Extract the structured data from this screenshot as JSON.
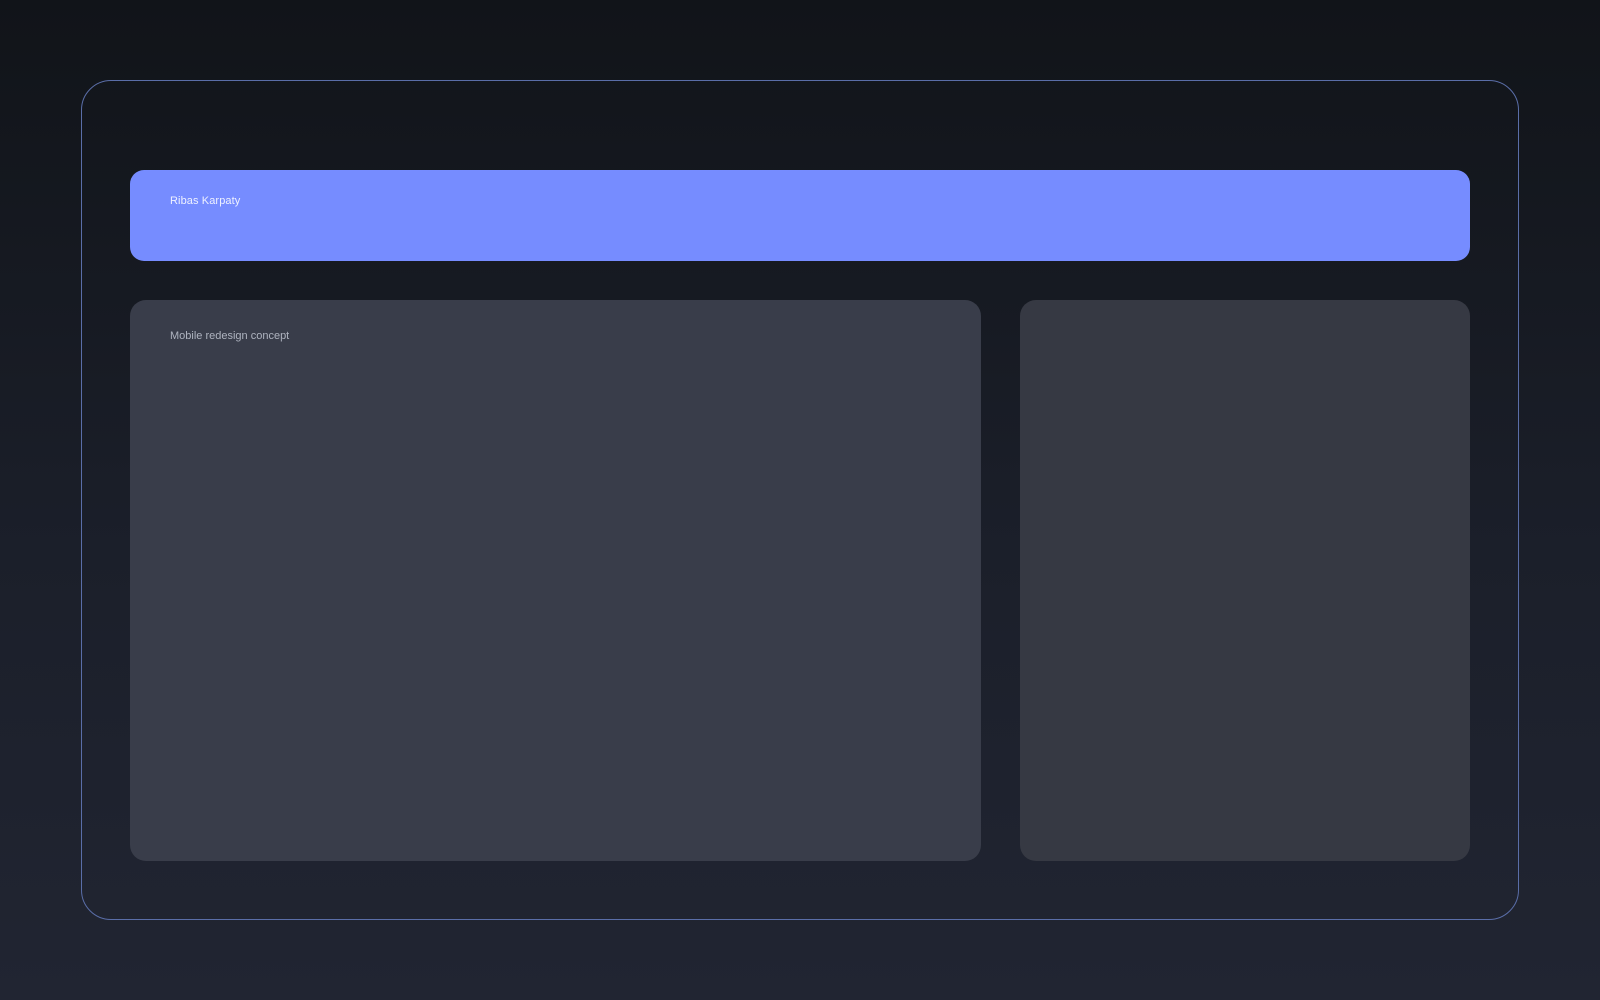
{
  "theme": {
    "accent": "#768cff",
    "main_panel_bg": "#393d4a",
    "side_panel_bg": "#363943",
    "frame_border": "#5a6ea8"
  },
  "header": {
    "title": "Ribas Karpaty"
  },
  "main_panel": {
    "title": "Mobile redesign concept"
  }
}
